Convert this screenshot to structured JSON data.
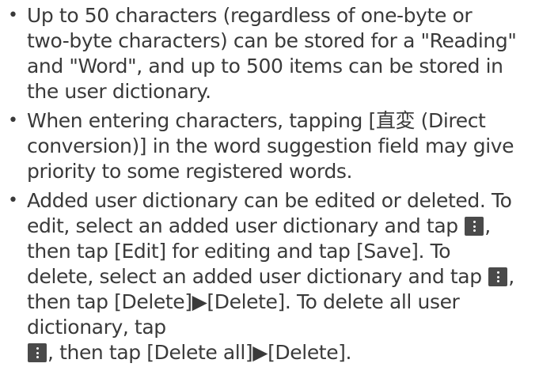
{
  "bullet_glyph": "•",
  "icons": {
    "menu_icon": "menu-icon"
  },
  "items": [
    {
      "text": "Up to 50 characters (regardless of one-byte or two-byte characters) can be stored for a \"Reading\" and \"Word\", and up to 500 items can be stored in the user dictionary."
    },
    {
      "text": "When entering characters, tapping [直変 (Direct conversion)] in the word suggestion field may give priority to some registered words."
    },
    {
      "parts": [
        "Added user dictionary can be edited or deleted. To edit, select an added user dictionary and tap ",
        ", then tap [Edit] for editing and tap [Save]. To delete, select an added user dictionary and tap ",
        ", then tap [Delete]▶[Delete]. To delete all user dictionary, tap ",
        ", then tap [Delete all]▶[Delete]."
      ]
    }
  ]
}
